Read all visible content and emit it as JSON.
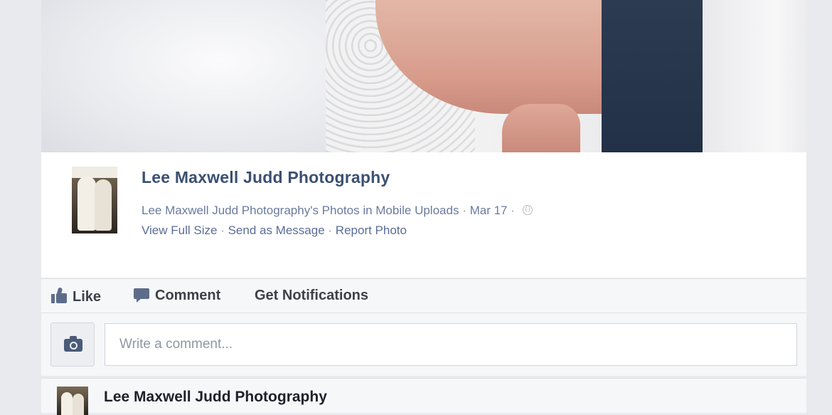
{
  "post": {
    "page_name": "Lee Maxwell Judd Photography",
    "album_line": "Lee Maxwell Judd Photography's Photos in Mobile Uploads",
    "date": "Mar 17",
    "links": {
      "view_full_size": "View Full Size",
      "send_as_message": "Send as Message",
      "report_photo": "Report Photo"
    }
  },
  "actions": {
    "like": "Like",
    "comment": "Comment",
    "get_notifications": "Get Notifications"
  },
  "comment_box": {
    "placeholder": "Write a comment...",
    "value": ""
  },
  "comment": {
    "author": "Lee Maxwell Judd Photography"
  },
  "icons": {
    "like": "thumbs-up-icon",
    "comment": "speech-bubble-icon",
    "camera": "camera-icon",
    "privacy": "globe-icon"
  },
  "colors": {
    "link": "#3b5071",
    "meta": "#6a7ba0",
    "action_text": "#3d4147"
  }
}
